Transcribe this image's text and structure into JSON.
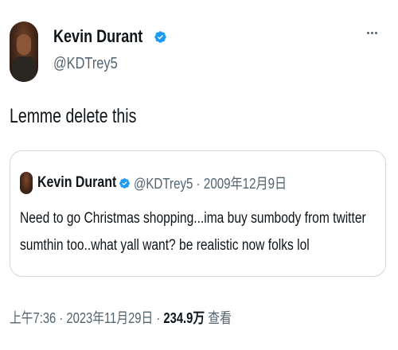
{
  "author": {
    "display_name": "Kevin Durant",
    "handle": "@KDTrey5",
    "verified_icon": "verified-badge-icon",
    "avatar_icon": "profile-photo"
  },
  "menu": {
    "more_icon": "more-options-icon"
  },
  "tweet": {
    "text": "Lemme delete this"
  },
  "quoted_tweet": {
    "display_name": "Kevin Durant",
    "handle": "@KDTrey5",
    "separator": "·",
    "date": "2009年12月9日",
    "text": "Need to go Christmas shopping...ima buy sumbody from twitter sumthin too..what yall want? be realistic now folks lol"
  },
  "footer": {
    "time": "上午7:36",
    "separator1": "·",
    "date": "2023年11月29日",
    "separator2": "·",
    "views_count": "234.9万",
    "views_label": "查看"
  },
  "colors": {
    "verified_blue": "#1d9bf0",
    "text_primary": "#0f1419",
    "text_secondary": "#536471",
    "border": "#cfd9de"
  }
}
